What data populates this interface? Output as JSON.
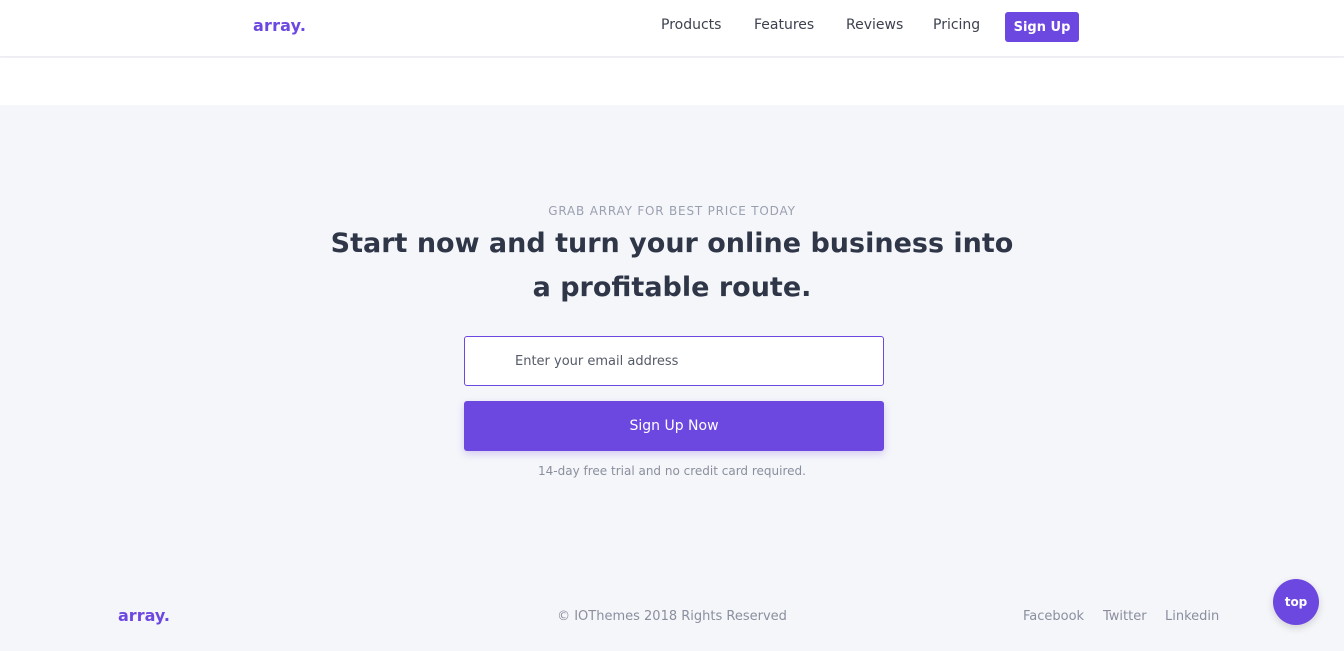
{
  "header": {
    "brand": "array.",
    "nav": [
      "Products",
      "Features",
      "Reviews",
      "Pricing"
    ],
    "signup_label": "Sign Up"
  },
  "cta": {
    "eyebrow": "GRAB ARRAY FOR BEST PRICE TODAY",
    "headline": "Start now and turn your online business into a profitable route.",
    "email_placeholder": "Enter your email address",
    "email_value": "",
    "submit_label": "Sign Up Now",
    "note": "14-day free trial and no credit card required."
  },
  "footer": {
    "brand": "array.",
    "copyright": "© IOThemes 2018 Rights Reserved",
    "links": [
      "Facebook",
      "Twitter",
      "Linkedin"
    ]
  },
  "scroll_top_label": "top",
  "colors": {
    "accent": "#6c47e0",
    "background": "#f5f6fa",
    "heading": "#2f3648",
    "muted": "#8a8f9e"
  }
}
